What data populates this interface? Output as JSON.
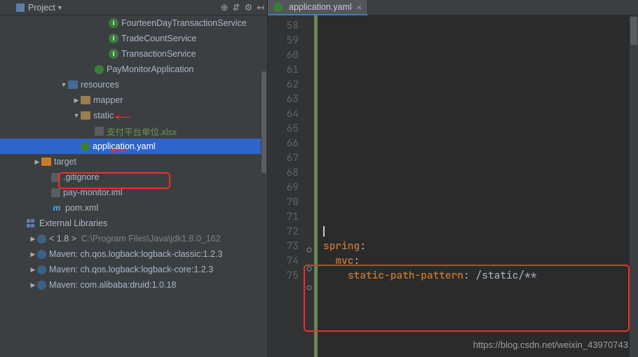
{
  "sidebar": {
    "title": "Project",
    "tools": [
      "⊕",
      "⇵",
      "⚙",
      "↤"
    ],
    "items": [
      {
        "indent": 119,
        "arrow": "",
        "iconClass": "i-interface",
        "iconText": "I",
        "label": "FourteenDayTransactionService",
        "cls": ""
      },
      {
        "indent": 119,
        "arrow": "",
        "iconClass": "i-interface",
        "iconText": "I",
        "label": "TradeCountService",
        "cls": ""
      },
      {
        "indent": 119,
        "arrow": "",
        "iconClass": "i-interface",
        "iconText": "I",
        "label": "TransactionService",
        "cls": ""
      },
      {
        "indent": 99,
        "arrow": "",
        "iconClass": "i-spring",
        "iconText": "",
        "label": "PayMonitorApplication",
        "cls": ""
      },
      {
        "indent": 61,
        "arrow": "▼",
        "iconClass": "i-folder blue",
        "iconText": "",
        "label": "resources",
        "cls": ""
      },
      {
        "indent": 79,
        "arrow": "▶",
        "iconClass": "i-folder",
        "iconText": "",
        "label": "mapper",
        "cls": ""
      },
      {
        "indent": 79,
        "arrow": "▼",
        "iconClass": "i-folder",
        "iconText": "",
        "label": "static",
        "cls": ""
      },
      {
        "indent": 99,
        "arrow": "",
        "iconClass": "i-text",
        "iconText": "",
        "label": "支付平台单位.xlsx",
        "cls": "txt-green"
      },
      {
        "indent": 79,
        "arrow": "",
        "iconClass": "i-spring",
        "iconText": "",
        "label": "application.yaml",
        "cls": "",
        "selected": true
      },
      {
        "indent": 23,
        "arrow": "▶",
        "iconClass": "i-folder orange",
        "iconText": "",
        "label": "target",
        "cls": ""
      },
      {
        "indent": 37,
        "arrow": "",
        "iconClass": "i-text",
        "iconText": "",
        "label": ".gitignore",
        "cls": ""
      },
      {
        "indent": 37,
        "arrow": "",
        "iconClass": "i-text",
        "iconText": "",
        "label": "pay-monitor.iml",
        "cls": ""
      },
      {
        "indent": 37,
        "arrow": "",
        "iconClass": "i-maven",
        "iconText": "m",
        "label": "pom.xml",
        "cls": ""
      },
      {
        "indent": 0,
        "arrow": "",
        "iconClass": "i-lib",
        "iconText": "lib",
        "label": "External Libraries",
        "cls": ""
      },
      {
        "indent": 17,
        "arrow": "▶",
        "iconClass": "i-java",
        "iconText": "",
        "label": "< 1.8 >",
        "extra": "C:\\Program Files\\Java\\jdk1.8.0_162",
        "cls": ""
      },
      {
        "indent": 17,
        "arrow": "▶",
        "iconClass": "i-java",
        "iconText": "",
        "label": "Maven: ch.qos.logback:logback-classic:1.2.3",
        "cls": ""
      },
      {
        "indent": 17,
        "arrow": "▶",
        "iconClass": "i-java",
        "iconText": "",
        "label": "Maven: ch.qos.logback:logback-core:1.2.3",
        "cls": ""
      },
      {
        "indent": 17,
        "arrow": "▶",
        "iconClass": "i-java",
        "iconText": "",
        "label": "Maven: com.alibaba:druid:1.0.18",
        "cls": ""
      }
    ]
  },
  "editor": {
    "tab": {
      "filename": "application.yaml"
    },
    "first_line": 58,
    "last_line": 75,
    "code": {
      "l73": {
        "k": "spring",
        "c": ":"
      },
      "l74": {
        "k": "mvc",
        "c": ":"
      },
      "l75": {
        "k": "static-path-pattern",
        "c": ": ",
        "v": "/static/**"
      }
    }
  },
  "chart_data": {
    "type": "table",
    "title": "application.yaml snippet",
    "rows": [
      {
        "line": 73,
        "text": "spring:"
      },
      {
        "line": 74,
        "text": "  mvc:"
      },
      {
        "line": 75,
        "text": "    static-path-pattern: /static/**"
      }
    ]
  },
  "watermark": "https://blog.csdn.net/weixin_43970743"
}
